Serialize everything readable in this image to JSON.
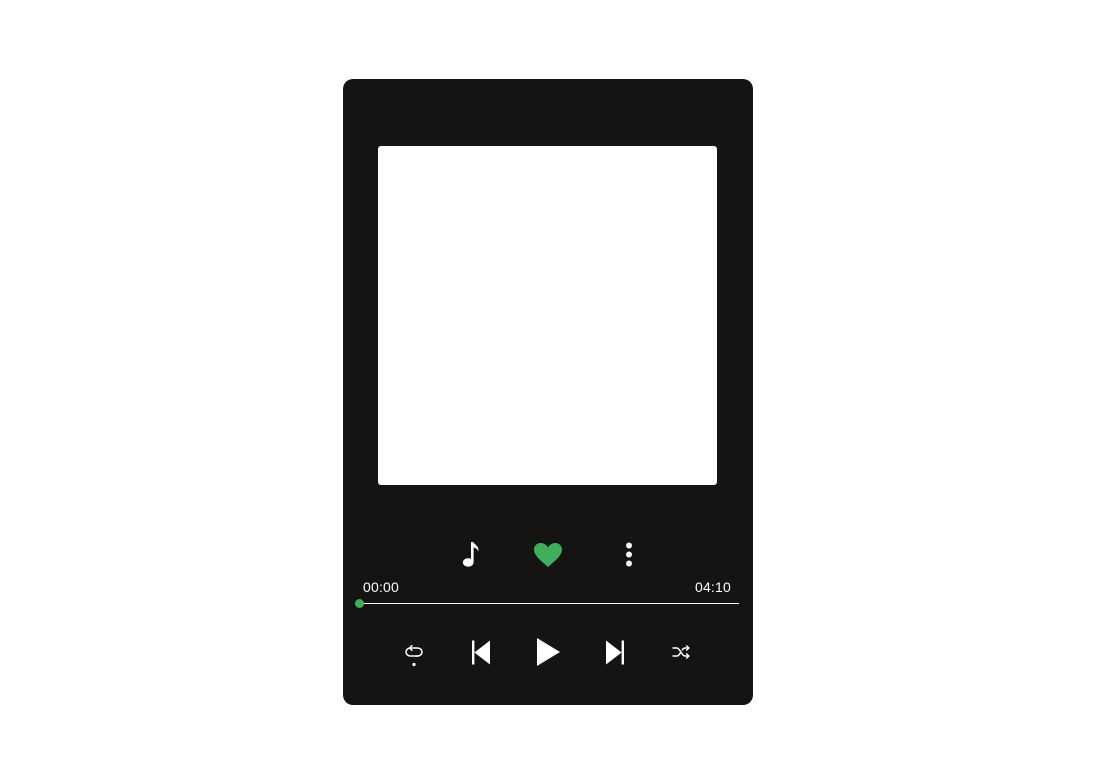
{
  "player": {
    "elapsed": "00:00",
    "duration": "04:10",
    "progress_fraction": 0.0,
    "liked": true
  },
  "colors": {
    "panel": "#151412",
    "artwork": "#ffffff",
    "accent": "#3fae5a",
    "foreground": "#ffffff"
  },
  "icons": {
    "top_row": [
      "music-note-icon",
      "heart-icon",
      "more-vertical-icon"
    ],
    "controls": [
      "repeat-icon",
      "skip-previous-icon",
      "play-icon",
      "skip-next-icon",
      "shuffle-icon"
    ]
  }
}
